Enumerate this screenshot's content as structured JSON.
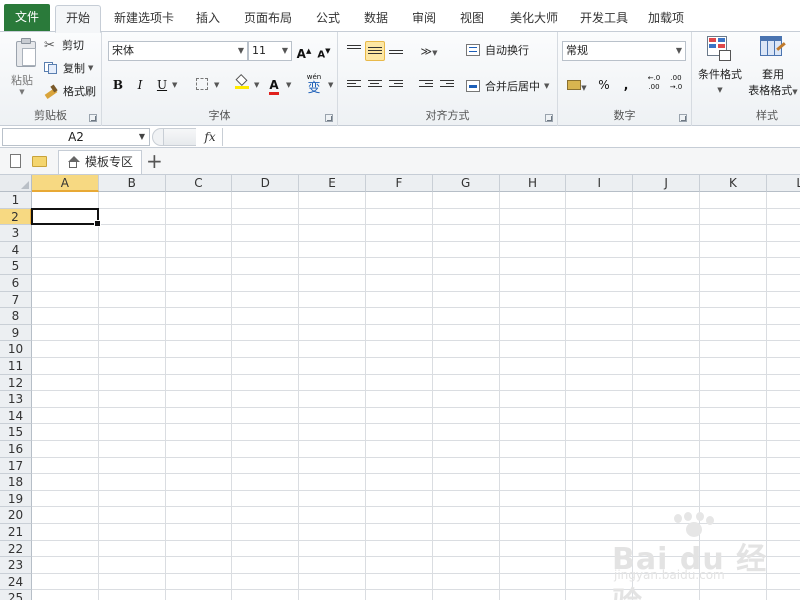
{
  "tabs": [
    {
      "label": "文件",
      "kind": "file"
    },
    {
      "label": "开始",
      "active": true
    },
    {
      "label": "新建选项卡"
    },
    {
      "label": "插入"
    },
    {
      "label": "页面布局"
    },
    {
      "label": "公式"
    },
    {
      "label": "数据"
    },
    {
      "label": "审阅"
    },
    {
      "label": "视图"
    },
    {
      "label": "美化大师"
    },
    {
      "label": "开发工具"
    },
    {
      "label": "加载项"
    }
  ],
  "clipboard": {
    "group_label": "剪贴板",
    "paste": "粘贴",
    "cut": "剪切",
    "copy": "复制",
    "format_painter": "格式刷"
  },
  "font": {
    "group_label": "字体",
    "font_name": "宋体",
    "font_size": "11",
    "bold": "B",
    "italic": "I",
    "underline": "U",
    "phonetic_top": "wén",
    "phonetic_bottom": "变",
    "increase_size": "A",
    "decrease_size": "A",
    "font_color_letter": "A"
  },
  "alignment": {
    "group_label": "对齐方式",
    "wrap_text": "自动换行",
    "merge_center": "合并后居中"
  },
  "number": {
    "group_label": "数字",
    "format": "常规",
    "percent": "%",
    "comma": ",",
    "inc_decimal": "←.0\n.00",
    "dec_decimal": ".00\n→.0"
  },
  "styles": {
    "group_label": "样式",
    "conditional_format": "条件格式",
    "table_format_top": "套用",
    "table_format_bottom": "表格格式"
  },
  "formula_bar": {
    "name_box": "A2",
    "fx": "fx",
    "formula": ""
  },
  "doc_tab": {
    "label": "模板专区"
  },
  "columns": [
    "A",
    "B",
    "C",
    "D",
    "E",
    "F",
    "G",
    "H",
    "I",
    "J",
    "K",
    "L"
  ],
  "rows": [
    "1",
    "2",
    "3",
    "4",
    "5",
    "6",
    "7",
    "8",
    "9",
    "10",
    "11",
    "12",
    "13",
    "14",
    "15",
    "16",
    "17",
    "18",
    "19",
    "20",
    "21",
    "22",
    "23",
    "24",
    "25"
  ],
  "active_cell": {
    "column": "A",
    "row": "2"
  },
  "watermark": {
    "text": "Bai du 经验",
    "url": "jingyan.baidu.com"
  },
  "colors": {
    "file_tab": "#2a7a3a",
    "selection": "#f7d982",
    "active_border": "#111111"
  }
}
